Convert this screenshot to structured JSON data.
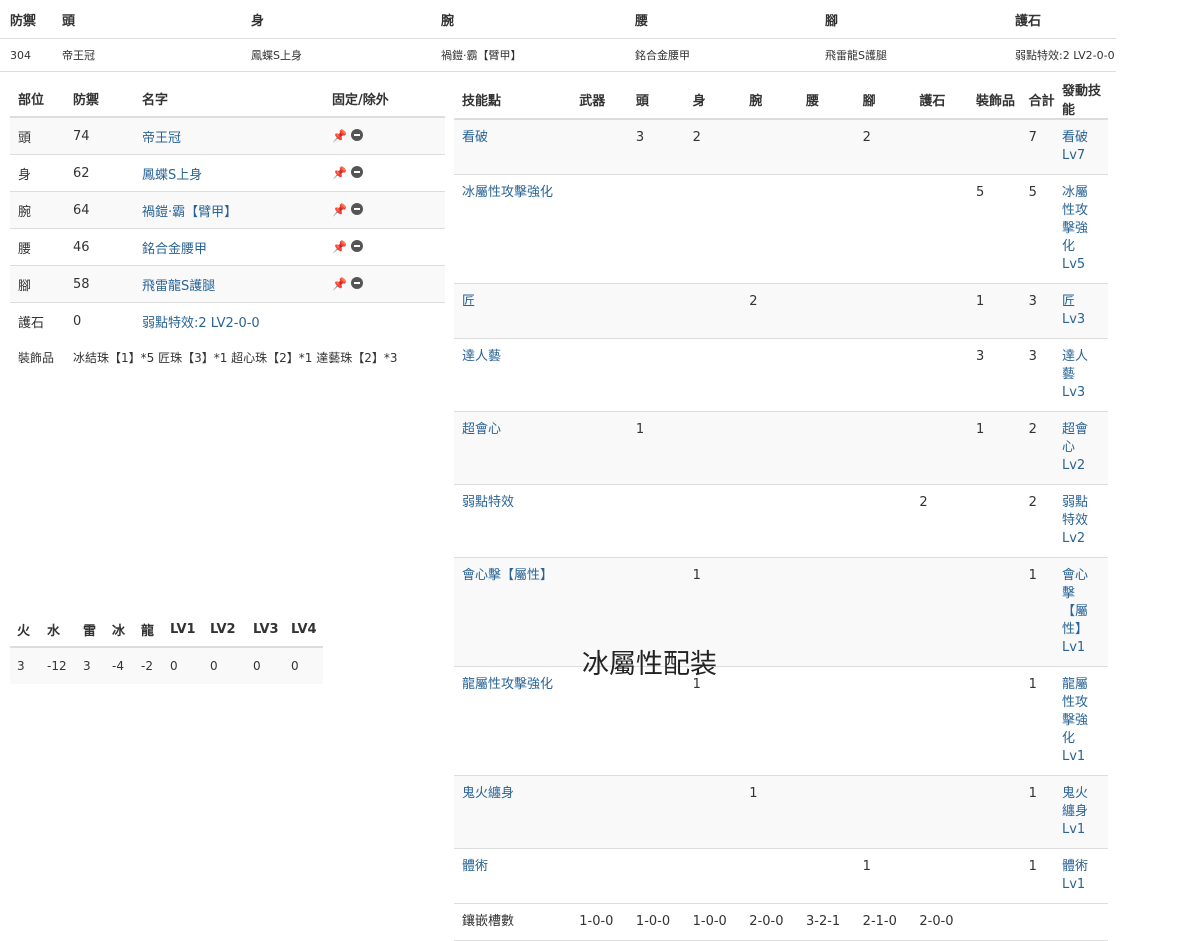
{
  "summary": {
    "headers": [
      "防禦",
      "頭",
      "身",
      "腕",
      "腰",
      "腳",
      "護石"
    ],
    "values": [
      "304",
      "帝王冠",
      "鳳蝶S上身",
      "禍鎧·霸【臂甲】",
      "銘合金腰甲",
      "飛雷龍S護腿",
      "弱點特效:2 LV2-0-0"
    ]
  },
  "parts": {
    "headers": [
      "部位",
      "防禦",
      "名字",
      "固定/除外"
    ],
    "rows": [
      {
        "part": "頭",
        "def": "74",
        "name": "帝王冠"
      },
      {
        "part": "身",
        "def": "62",
        "name": "鳳蝶S上身"
      },
      {
        "part": "腕",
        "def": "64",
        "name": "禍鎧·霸【臂甲】"
      },
      {
        "part": "腰",
        "def": "46",
        "name": "銘合金腰甲"
      },
      {
        "part": "腳",
        "def": "58",
        "name": "飛雷龍S護腿"
      },
      {
        "part": "護石",
        "def": "0",
        "name": "弱點特效:2 LV2-0-0"
      }
    ],
    "decorations_label": "裝飾品",
    "decorations_value": "冰結珠【1】*5 匠珠【3】*1 超心珠【2】*1 達藝珠【2】*3"
  },
  "skills": {
    "headers": [
      "技能點",
      "武器",
      "頭",
      "身",
      "腕",
      "腰",
      "腳",
      "護石",
      "裝飾品",
      "合計",
      "發動技能"
    ],
    "rows": [
      {
        "name": "看破",
        "weapon": "",
        "head": "3",
        "body": "2",
        "arm": "",
        "waist": "",
        "leg": "2",
        "charm": "",
        "deco": "",
        "total": "7",
        "active": "看破Lv7"
      },
      {
        "name": "冰屬性攻擊強化",
        "weapon": "",
        "head": "",
        "body": "",
        "arm": "",
        "waist": "",
        "leg": "",
        "charm": "",
        "deco": "5",
        "total": "5",
        "active": "冰屬性攻擊強化Lv5"
      },
      {
        "name": "匠",
        "weapon": "",
        "head": "",
        "body": "",
        "arm": "2",
        "waist": "",
        "leg": "",
        "charm": "",
        "deco": "1",
        "total": "3",
        "active": "匠Lv3"
      },
      {
        "name": "達人藝",
        "weapon": "",
        "head": "",
        "body": "",
        "arm": "",
        "waist": "",
        "leg": "",
        "charm": "",
        "deco": "3",
        "total": "3",
        "active": "達人藝Lv3"
      },
      {
        "name": "超會心",
        "weapon": "",
        "head": "1",
        "body": "",
        "arm": "",
        "waist": "",
        "leg": "",
        "charm": "",
        "deco": "1",
        "total": "2",
        "active": "超會心Lv2"
      },
      {
        "name": "弱點特效",
        "weapon": "",
        "head": "",
        "body": "",
        "arm": "",
        "waist": "",
        "leg": "",
        "charm": "2",
        "deco": "",
        "total": "2",
        "active": "弱點特效Lv2"
      },
      {
        "name": "會心擊【屬性】",
        "weapon": "",
        "head": "",
        "body": "1",
        "arm": "",
        "waist": "",
        "leg": "",
        "charm": "",
        "deco": "",
        "total": "1",
        "active": "會心擊【屬性】Lv1"
      },
      {
        "name": "龍屬性攻擊強化",
        "weapon": "",
        "head": "",
        "body": "1",
        "arm": "",
        "waist": "",
        "leg": "",
        "charm": "",
        "deco": "",
        "total": "1",
        "active": "龍屬性攻擊強化Lv1"
      },
      {
        "name": "鬼火纏身",
        "weapon": "",
        "head": "",
        "body": "",
        "arm": "1",
        "waist": "",
        "leg": "",
        "charm": "",
        "deco": "",
        "total": "1",
        "active": "鬼火纏身Lv1"
      },
      {
        "name": "體術",
        "weapon": "",
        "head": "",
        "body": "",
        "arm": "",
        "waist": "",
        "leg": "1",
        "charm": "",
        "deco": "",
        "total": "1",
        "active": "體術Lv1"
      }
    ],
    "slots_label": "鑲嵌槽數",
    "slots": [
      "1-0-0",
      "1-0-0",
      "1-0-0",
      "2-0-0",
      "3-2-1",
      "2-1-0",
      "2-0-0"
    ]
  },
  "resist": {
    "headers": [
      "火",
      "水",
      "雷",
      "冰",
      "龍",
      "LV1",
      "LV2",
      "LV3",
      "LV4"
    ],
    "values": [
      "3",
      "-12",
      "3",
      "-4",
      "-2",
      "0",
      "0",
      "0",
      "0"
    ]
  },
  "title": "冰屬性配装",
  "icons": {
    "pin": "pin-icon",
    "exclude": "minus-circle-icon"
  },
  "colors": {
    "link": "#2a6496",
    "stripe": "#f9f9f9",
    "border": "#dddddd"
  }
}
